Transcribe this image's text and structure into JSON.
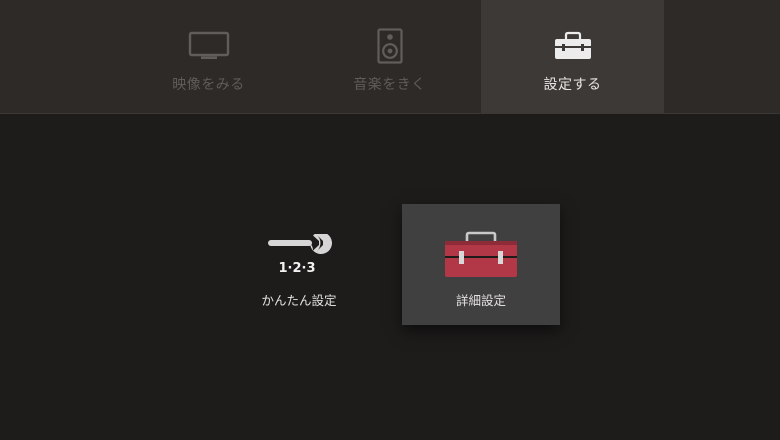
{
  "colors": {
    "background": "#1d1c1b",
    "top_bar": "#2d2a28",
    "active_tab": "#3c3936",
    "selected_card": "#414040",
    "toolbox_red": "#b23848"
  },
  "top_tabs": [
    {
      "label": "映像をみる",
      "icon": "tv-icon",
      "active": false
    },
    {
      "label": "音楽をきく",
      "icon": "speaker-icon",
      "active": false
    },
    {
      "label": "設定する",
      "icon": "toolbox-icon",
      "active": true
    }
  ],
  "settings_options": [
    {
      "label": "かんたん設定",
      "icon": "wrench-icon",
      "steps_text": "1·2·3",
      "selected": false
    },
    {
      "label": "詳細設定",
      "icon": "toolbox-icon",
      "selected": true
    }
  ]
}
